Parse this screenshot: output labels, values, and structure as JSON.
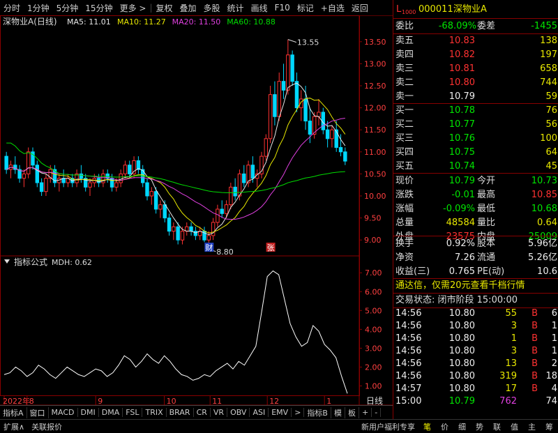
{
  "topbar": {
    "items": [
      "分时",
      "1分钟",
      "5分钟",
      "15分钟",
      "更多 >",
      "复权",
      "叠加",
      "多股",
      "统计",
      "画线",
      "F10",
      "标记",
      "+自选",
      "返回"
    ]
  },
  "chart_data": [
    {
      "type": "candlestick",
      "title": "深物业A(日线)",
      "ma_labels": [
        {
          "name": "MA5",
          "value": "11.01",
          "color": "#e8e8e8"
        },
        {
          "name": "MA10",
          "value": "11.27",
          "color": "#e8e800"
        },
        {
          "name": "MA20",
          "value": "11.50",
          "color": "#e040e0"
        },
        {
          "name": "MA60",
          "value": "10.88",
          "color": "#00dd00"
        }
      ],
      "y_ticks": [
        "13.50",
        "13.00",
        "12.50",
        "12.00",
        "11.50",
        "11.00",
        "10.50",
        "10.00",
        "9.50",
        "9.00"
      ],
      "ylim": [
        8.75,
        13.75
      ],
      "annotations": {
        "high": "13.55",
        "low": "8.80",
        "marker_cai": "财",
        "marker_zhang": "张"
      },
      "ohlc": [
        [
          10.9,
          11.0,
          10.5,
          10.6
        ],
        [
          10.6,
          10.8,
          10.4,
          10.7
        ],
        [
          10.7,
          10.9,
          10.5,
          10.6
        ],
        [
          10.6,
          10.7,
          10.3,
          10.4
        ],
        [
          10.4,
          10.6,
          10.2,
          10.5
        ],
        [
          10.5,
          11.1,
          10.4,
          11.0
        ],
        [
          11.0,
          11.1,
          10.6,
          10.7
        ],
        [
          10.7,
          10.8,
          10.2,
          10.3
        ],
        [
          10.3,
          10.4,
          10.0,
          10.1
        ],
        [
          10.1,
          10.5,
          10.0,
          10.4
        ],
        [
          10.4,
          10.7,
          10.3,
          10.6
        ],
        [
          10.6,
          10.7,
          10.2,
          10.3
        ],
        [
          10.3,
          10.5,
          10.1,
          10.4
        ],
        [
          10.4,
          10.6,
          10.2,
          10.3
        ],
        [
          10.3,
          10.5,
          10.2,
          10.4
        ],
        [
          10.4,
          10.5,
          10.2,
          10.3
        ],
        [
          10.3,
          10.6,
          10.2,
          10.5
        ],
        [
          10.5,
          10.7,
          10.3,
          10.4
        ],
        [
          10.4,
          10.5,
          10.1,
          10.2
        ],
        [
          10.2,
          10.4,
          10.0,
          10.3
        ],
        [
          10.3,
          10.5,
          10.2,
          10.4
        ],
        [
          10.4,
          10.5,
          10.2,
          10.3
        ],
        [
          10.3,
          10.6,
          10.2,
          10.5
        ],
        [
          10.5,
          10.6,
          10.3,
          10.4
        ],
        [
          10.4,
          10.5,
          10.1,
          10.2
        ],
        [
          10.2,
          10.4,
          10.1,
          10.3
        ],
        [
          10.3,
          10.6,
          10.2,
          10.5
        ],
        [
          10.5,
          10.8,
          10.4,
          10.7
        ],
        [
          10.7,
          10.8,
          10.4,
          10.5
        ],
        [
          10.5,
          10.9,
          10.4,
          10.8
        ],
        [
          10.8,
          10.9,
          10.5,
          10.6
        ],
        [
          10.6,
          10.7,
          10.2,
          10.3
        ],
        [
          10.3,
          10.4,
          9.9,
          10.0
        ],
        [
          10.0,
          10.2,
          9.8,
          10.1
        ],
        [
          10.1,
          10.2,
          9.6,
          9.7
        ],
        [
          9.7,
          9.9,
          9.5,
          9.8
        ],
        [
          9.8,
          9.9,
          9.4,
          9.5
        ],
        [
          9.5,
          9.6,
          9.1,
          9.2
        ],
        [
          9.2,
          9.4,
          9.0,
          9.3
        ],
        [
          9.3,
          9.4,
          8.9,
          9.0
        ],
        [
          9.0,
          9.3,
          8.9,
          9.2
        ],
        [
          9.2,
          9.4,
          9.1,
          9.3
        ],
        [
          9.3,
          9.4,
          9.1,
          9.2
        ],
        [
          9.2,
          9.3,
          9.0,
          9.1
        ],
        [
          9.1,
          9.3,
          9.0,
          9.2
        ],
        [
          9.2,
          9.3,
          8.95,
          9.0
        ],
        [
          9.0,
          9.2,
          8.8,
          9.1
        ],
        [
          9.1,
          9.5,
          9.0,
          9.4
        ],
        [
          9.4,
          9.8,
          9.3,
          9.7
        ],
        [
          9.7,
          9.9,
          9.5,
          9.6
        ],
        [
          9.6,
          9.9,
          9.5,
          9.8
        ],
        [
          9.8,
          10.3,
          9.7,
          10.2
        ],
        [
          10.2,
          10.4,
          9.9,
          10.0
        ],
        [
          10.0,
          10.6,
          9.9,
          10.5
        ],
        [
          10.5,
          10.7,
          10.2,
          10.3
        ],
        [
          10.3,
          10.8,
          10.2,
          10.7
        ],
        [
          10.7,
          10.9,
          10.3,
          10.4
        ],
        [
          10.4,
          10.6,
          10.2,
          10.5
        ],
        [
          10.5,
          11.0,
          10.4,
          10.9
        ],
        [
          10.9,
          11.4,
          10.8,
          11.3
        ],
        [
          11.3,
          12.5,
          11.2,
          12.3
        ],
        [
          12.3,
          12.6,
          11.6,
          11.8
        ],
        [
          11.8,
          12.8,
          11.7,
          12.6
        ],
        [
          12.6,
          13.0,
          12.2,
          12.4
        ],
        [
          12.4,
          13.55,
          12.3,
          13.2
        ],
        [
          13.2,
          13.3,
          12.5,
          12.6
        ],
        [
          12.6,
          12.8,
          11.9,
          12.0
        ],
        [
          12.0,
          12.4,
          11.7,
          12.2
        ],
        [
          12.2,
          12.5,
          11.5,
          11.7
        ],
        [
          11.7,
          12.0,
          11.2,
          11.4
        ],
        [
          11.4,
          11.9,
          11.3,
          11.8
        ],
        [
          11.8,
          12.2,
          11.6,
          11.9
        ],
        [
          11.9,
          12.0,
          11.4,
          11.5
        ],
        [
          11.5,
          11.7,
          11.1,
          11.3
        ],
        [
          11.3,
          11.6,
          11.1,
          11.5
        ],
        [
          11.5,
          11.7,
          11.0,
          11.1
        ],
        [
          11.1,
          11.4,
          10.9,
          11.0
        ],
        [
          11.0,
          11.1,
          10.7,
          10.79
        ]
      ]
    },
    {
      "type": "line",
      "title": "指标公式",
      "series_label": "MDH: 0.62",
      "y_ticks": [
        "7.00",
        "6.00",
        "5.00",
        "4.00",
        "3.00",
        "2.00",
        "1.00"
      ],
      "ylim": [
        0.5,
        7.6
      ],
      "x_labels": [
        "2022年",
        "8",
        "9",
        "10",
        "11",
        "12",
        "1"
      ],
      "x_label_idx": [
        0,
        4,
        16,
        28,
        36,
        46,
        56
      ],
      "values": [
        1.6,
        1.7,
        2.0,
        1.8,
        1.5,
        1.7,
        2.1,
        1.9,
        1.6,
        1.4,
        1.7,
        2.0,
        1.8,
        1.6,
        1.5,
        1.7,
        1.9,
        1.8,
        1.5,
        1.7,
        2.1,
        2.6,
        2.4,
        2.0,
        2.3,
        2.7,
        2.4,
        2.2,
        2.6,
        2.3,
        1.9,
        1.6,
        1.5,
        1.3,
        1.4,
        1.6,
        1.5,
        1.8,
        2.0,
        2.2,
        1.9,
        2.3,
        2.1,
        2.6,
        3.1,
        4.9,
        6.8,
        7.1,
        6.9,
        5.6,
        4.3,
        3.6,
        3.1,
        3.3,
        4.2,
        3.9,
        3.2,
        2.9,
        2.5,
        1.5,
        0.6
      ]
    }
  ],
  "right_panel": {
    "stock_code": "000011",
    "stock_name": "深物业A",
    "wei_bi_label": "委比",
    "wei_bi": "-68.09%",
    "wei_cha_label": "委差",
    "wei_cha": "-1455",
    "asks": [
      {
        "label": "卖五",
        "price": "10.83",
        "vol": "138"
      },
      {
        "label": "卖四",
        "price": "10.82",
        "vol": "197"
      },
      {
        "label": "卖三",
        "price": "10.81",
        "vol": "658"
      },
      {
        "label": "卖二",
        "price": "10.80",
        "vol": "744"
      },
      {
        "label": "卖一",
        "price": "10.79",
        "vol": "59"
      }
    ],
    "bids": [
      {
        "label": "买一",
        "price": "10.78",
        "vol": "76"
      },
      {
        "label": "买二",
        "price": "10.77",
        "vol": "56"
      },
      {
        "label": "买三",
        "price": "10.76",
        "vol": "100"
      },
      {
        "label": "买四",
        "price": "10.75",
        "vol": "64"
      },
      {
        "label": "买五",
        "price": "10.74",
        "vol": "45"
      }
    ],
    "quote": [
      {
        "l1": "现价",
        "v1": "10.79",
        "c1": "grn",
        "l2": "今开",
        "v2": "10.73",
        "c2": "grn"
      },
      {
        "l1": "涨跌",
        "v1": "-0.01",
        "c1": "grn",
        "l2": "最高",
        "v2": "10.85",
        "c2": "red"
      },
      {
        "l1": "涨幅",
        "v1": "-0.09%",
        "c1": "grn",
        "l2": "最低",
        "v2": "10.68",
        "c2": "grn"
      },
      {
        "l1": "总量",
        "v1": "48584",
        "c1": "yel",
        "l2": "量比",
        "v2": "0.64",
        "c2": "yel"
      },
      {
        "l1": "外盘",
        "v1": "23575",
        "c1": "red",
        "l2": "内盘",
        "v2": "25009",
        "c2": "grn"
      }
    ],
    "fin": [
      {
        "l1": "换手",
        "v1": "0.92%",
        "l2": "股本",
        "v2": "5.96亿"
      },
      {
        "l1": "净资",
        "v1": "7.26",
        "l2": "流通",
        "v2": "5.26亿"
      },
      {
        "l1": "收益(三)",
        "v1": "0.765",
        "l2": "PE(动)",
        "v2": "10.6"
      }
    ],
    "ad_text": "通达信，仅需20元查看千档行情",
    "trade_status": "交易状态: 闭市阶段  15:00:00",
    "ticks": [
      {
        "t": "14:56",
        "p": "10.80",
        "v": "55",
        "bs": "B",
        "n": "6"
      },
      {
        "t": "14:56",
        "p": "10.80",
        "v": "3",
        "bs": "B",
        "n": "1"
      },
      {
        "t": "14:56",
        "p": "10.80",
        "v": "1",
        "bs": "B",
        "n": "1"
      },
      {
        "t": "14:56",
        "p": "10.80",
        "v": "3",
        "bs": "B",
        "n": "1"
      },
      {
        "t": "14:56",
        "p": "10.80",
        "v": "13",
        "bs": "B",
        "n": "2"
      },
      {
        "t": "14:56",
        "p": "10.80",
        "v": "319",
        "bs": "B",
        "n": "18"
      },
      {
        "t": "14:57",
        "p": "10.80",
        "v": "17",
        "bs": "B",
        "n": "4"
      },
      {
        "t": "15:00",
        "p": "10.79",
        "v": "762",
        "bs": "",
        "n": "74"
      }
    ],
    "right_bottom": "日线"
  },
  "bottom_tabs": [
    "指标A",
    "窗口",
    "MACD",
    "DMI",
    "DMA",
    "FSL",
    "TRIX",
    "BRAR",
    "CR",
    "VR",
    "OBV",
    "ASI",
    "EMV",
    ">",
    "指标B",
    "模",
    "板",
    "+",
    "-"
  ],
  "footer": {
    "left": [
      "扩展∧",
      "关联报价"
    ],
    "right_text": "新用户福利专享",
    "right_tabs": [
      "笔",
      "价",
      "细",
      "势",
      "联",
      "值",
      "主",
      "筹"
    ]
  }
}
